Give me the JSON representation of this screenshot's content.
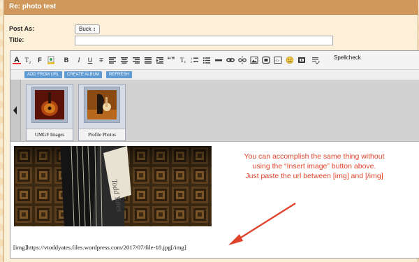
{
  "header": {
    "title": "Re: photo test"
  },
  "form": {
    "post_as_label": "Post As:",
    "post_as_value": "Buck",
    "title_label": "Title:",
    "title_value": ""
  },
  "toolbar": {
    "buttons": [
      "font-color",
      "font-size",
      "font-family",
      "highlight",
      "bold",
      "italic",
      "underline",
      "strikethrough",
      "align-left",
      "align-center",
      "align-right",
      "justify",
      "quote",
      "remove-format",
      "numbered-list",
      "bulleted-list",
      "horizontal-rule",
      "link",
      "unlink",
      "image",
      "code",
      "emoji",
      "media",
      "spellcheck-icon"
    ],
    "spellcheck_label": "Spellcheck"
  },
  "media_buttons": {
    "add_from_url": "ADD FROM URL",
    "create_album": "CREATE ALBUM",
    "refresh": "REFRESH"
  },
  "albums": [
    {
      "name": "UMGF Images"
    },
    {
      "name": "Profile Photos"
    }
  ],
  "annotation": {
    "line1": "You can accomplish the same thing without",
    "line2": "using the “Insert image” button above.",
    "line3": "Just paste the url between [img] and [/img]"
  },
  "editor_content": {
    "img_code": "[img]https://vtoddyates.files.wordpress.com/2017/07/file-18.jpg[/img]"
  },
  "colors": {
    "titlebar": "#d0985a",
    "annotation": "#e0432b",
    "button_blue": "#5f9ad3"
  }
}
